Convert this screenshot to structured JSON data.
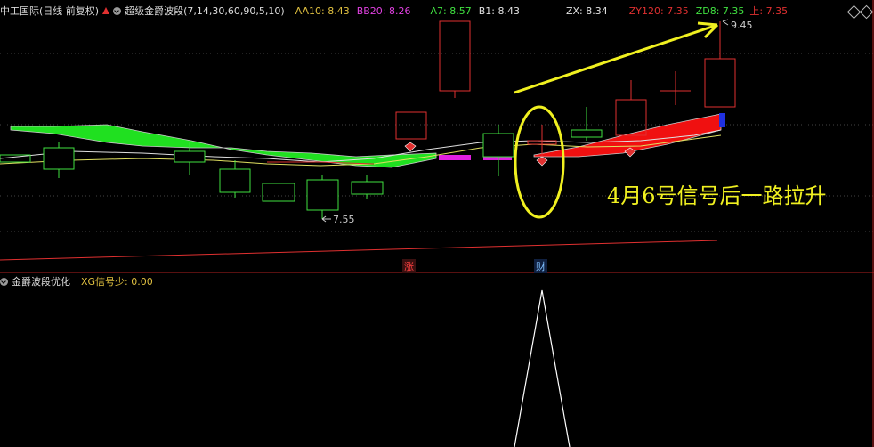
{
  "header": {
    "stock": "中工国际(日线 前复权)",
    "indicator": "超级金爵波段(7,14,30,60,90,5,10)",
    "aa10": "AA10: 8.43",
    "bb20": "BB20: 8.26",
    "a7": "A7: 8.57",
    "b1": "B1: 8.43",
    "zx": "ZX: 8.34",
    "zy120": "ZY120: 7.35",
    "zd8": "ZD8: 7.35",
    "shang": "上: 7.35",
    "colors": {
      "aa10": "#e0c040",
      "bb20": "#e040e0",
      "a7": "#40e040",
      "b1": "#e0e0e0",
      "zx": "#e0e0e0",
      "zy120": "#e03030",
      "zd8": "#40e040",
      "shang": "#e03030"
    }
  },
  "chart": {
    "high_label": "9.45",
    "low_label": "7.55",
    "annotation": "4月6号信号后一路拉升",
    "mark_zhang": "涨",
    "mark_cai": "财"
  },
  "sub": {
    "title": "金爵波段优化",
    "xg": "XG信号少: 0.00"
  }
}
